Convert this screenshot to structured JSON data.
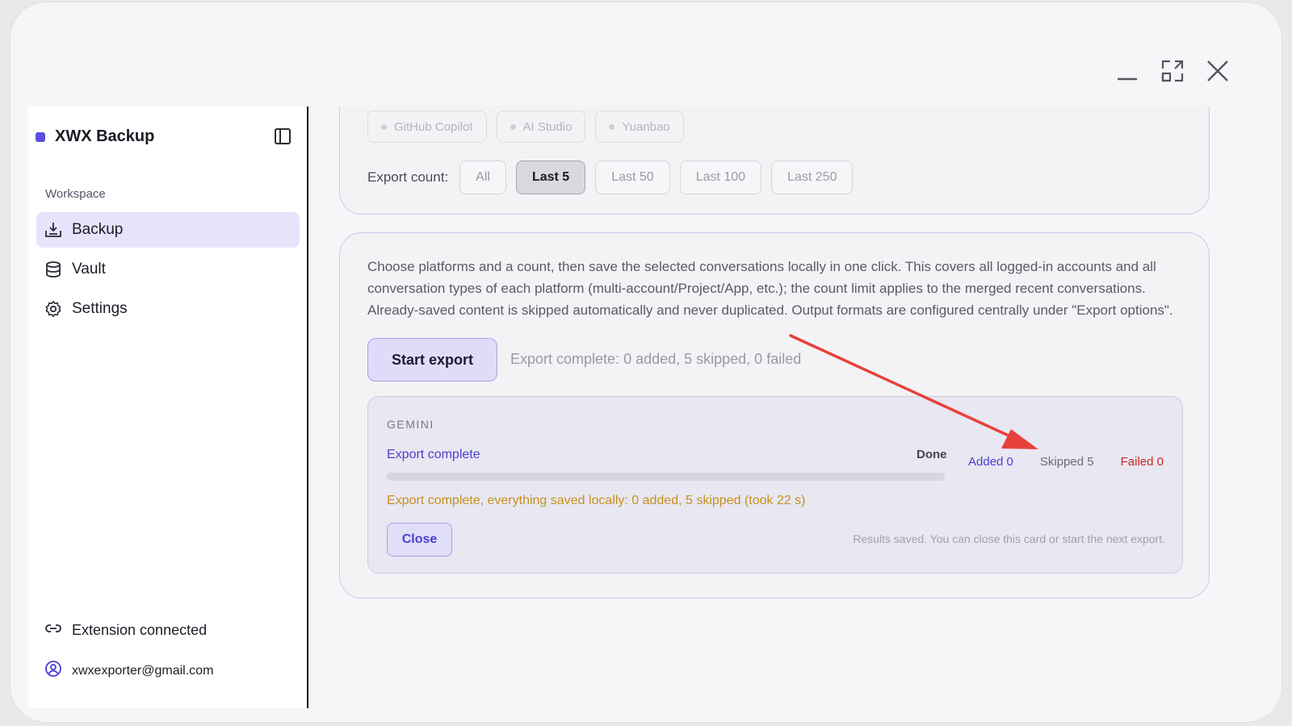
{
  "app": {
    "name": "XWX Backup",
    "accent": "#5a4fe0"
  },
  "sidebar": {
    "section_label": "Workspace",
    "items": [
      {
        "label": "Backup",
        "icon": "download-tray-icon",
        "active": true
      },
      {
        "label": "Vault",
        "icon": "database-icon",
        "active": false
      },
      {
        "label": "Settings",
        "icon": "gear-icon",
        "active": false
      }
    ],
    "extension_status": "Extension connected",
    "account_email": "xwxexporter@gmail.com"
  },
  "platforms": {
    "chips": [
      "GitHub Copilot",
      "AI Studio",
      "Yuanbao"
    ]
  },
  "export_count": {
    "label": "Export count:",
    "options": [
      "All",
      "Last 5",
      "Last 50",
      "Last 100",
      "Last 250"
    ],
    "selected": "Last 5"
  },
  "main": {
    "description": "Choose platforms and a count, then save the selected conversations locally in one click. This covers all logged-in accounts and all conversation types of each platform (multi-account/Project/App, etc.); the count limit applies to the merged recent conversations. Already-saved content is skipped automatically and never duplicated. Output formats are configured centrally under \"Export options\".",
    "start_button": "Start export",
    "status": "Export complete: 0 added, 5 skipped, 0 failed"
  },
  "gemini_card": {
    "title": "GEMINI",
    "status": "Export complete",
    "done_label": "Done",
    "progress": 1.0,
    "added": "Added 0",
    "skipped": "Skipped 5",
    "failed": "Failed 0",
    "message": "Export complete, everything saved locally: 0 added, 5 skipped (took 22 s)",
    "close_button": "Close",
    "hint": "Results saved. You can close this card or start the next export."
  },
  "colors": {
    "added": "#4a3fd0",
    "failed": "#d02424",
    "warning": "#c8901a",
    "annotation_arrow": "#e8413c"
  }
}
